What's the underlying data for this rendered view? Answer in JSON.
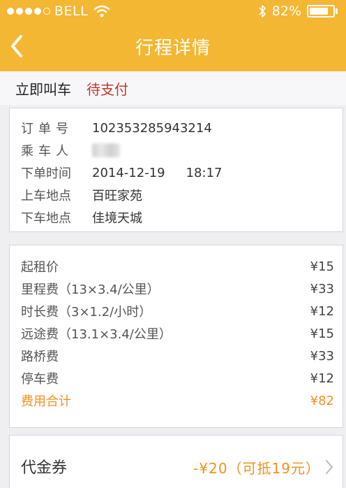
{
  "status_bar": {
    "carrier": "BELL",
    "battery": "82%",
    "battery_level": 0.82,
    "signal_bars": 5,
    "signal_filled": 4
  },
  "nav": {
    "title": "行程详情"
  },
  "order_status": {
    "type": "立即叫车",
    "state": "待支付"
  },
  "order_info": {
    "order_no_label": "订单号",
    "order_no": "102353285943214",
    "passenger_label": "乘车人",
    "time_label": "下单时间",
    "date": "2014-12-19",
    "time": "18:17",
    "pickup_label": "上车地点",
    "pickup": "百旺家苑",
    "dropoff_label": "下车地点",
    "dropoff": "佳境天城"
  },
  "fees": {
    "items": [
      {
        "label": "起租价",
        "amount": "¥15"
      },
      {
        "label": "里程费（13×3.4/公里）",
        "amount": "¥33"
      },
      {
        "label": "时长费（3×1.2/小时）",
        "amount": "¥12"
      },
      {
        "label": "远途费（13.1×3.4/公里）",
        "amount": "¥15"
      },
      {
        "label": "路桥费",
        "amount": "¥33"
      },
      {
        "label": "停车费",
        "amount": "¥12"
      }
    ],
    "total_label": "费用合计",
    "total_amount": "¥82"
  },
  "coupon": {
    "label": "代金券",
    "value": "-¥20（可抵19元）"
  },
  "colors": {
    "header": "#f4b733",
    "status_red": "#c6372d",
    "accent_orange": "#f29020"
  },
  "icons": {
    "back": "chevron-left-icon",
    "wifi": "wifi-icon",
    "bluetooth": "bluetooth-icon",
    "battery": "battery-icon",
    "coupon_arrow": "chevron-right-icon"
  }
}
